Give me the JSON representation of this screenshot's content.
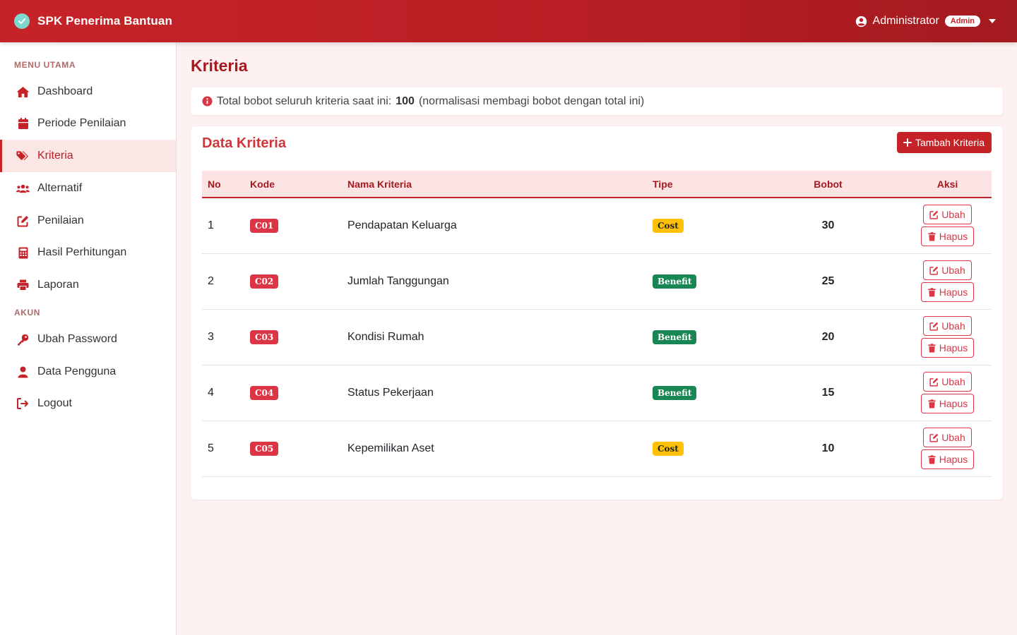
{
  "app": {
    "title": "SPK Penerima Bantuan"
  },
  "user": {
    "name": "Administrator",
    "role": "Admin"
  },
  "sidebar": {
    "sections": [
      {
        "label": "MENU UTAMA"
      },
      {
        "label": "AKUN"
      }
    ],
    "items": [
      {
        "label": "Dashboard",
        "icon": "home-icon"
      },
      {
        "label": "Periode Penilaian",
        "icon": "calendar-icon"
      },
      {
        "label": "Kriteria",
        "icon": "tags-icon",
        "active": true
      },
      {
        "label": "Alternatif",
        "icon": "users-icon"
      },
      {
        "label": "Penilaian",
        "icon": "edit-icon"
      },
      {
        "label": "Hasil Perhitungan",
        "icon": "calculator-icon"
      },
      {
        "label": "Laporan",
        "icon": "print-icon"
      },
      {
        "label": "Ubah Password",
        "icon": "key-icon"
      },
      {
        "label": "Data Pengguna",
        "icon": "user-icon"
      },
      {
        "label": "Logout",
        "icon": "logout-icon"
      }
    ]
  },
  "page": {
    "title": "Kriteria"
  },
  "info": {
    "prefix": "Total bobot seluruh kriteria saat ini:",
    "total": "100",
    "suffix": "(normalisasi membagi bobot dengan total ini)"
  },
  "card": {
    "title": "Data Kriteria",
    "add_label": "Tambah Kriteria"
  },
  "table": {
    "headers": {
      "no": "No",
      "kode": "Kode",
      "nama": "Nama Kriteria",
      "tipe": "Tipe",
      "bobot": "Bobot",
      "aksi": "Aksi"
    },
    "edit_label": "Ubah",
    "delete_label": "Hapus",
    "rows": [
      {
        "no": "1",
        "kode": "C01",
        "nama": "Pendapatan Keluarga",
        "tipe": "Cost",
        "bobot": "30"
      },
      {
        "no": "2",
        "kode": "C02",
        "nama": "Jumlah Tanggungan",
        "tipe": "Benefit",
        "bobot": "25"
      },
      {
        "no": "3",
        "kode": "C03",
        "nama": "Kondisi Rumah",
        "tipe": "Benefit",
        "bobot": "20"
      },
      {
        "no": "4",
        "kode": "C04",
        "nama": "Status Pekerjaan",
        "tipe": "Benefit",
        "bobot": "15"
      },
      {
        "no": "5",
        "kode": "C05",
        "nama": "Kepemilikan Aset",
        "tipe": "Cost",
        "bobot": "10"
      }
    ]
  },
  "colors": {
    "primary": "#c62328",
    "danger": "#dc3545",
    "cost": "#ffc107",
    "benefit": "#198754"
  }
}
